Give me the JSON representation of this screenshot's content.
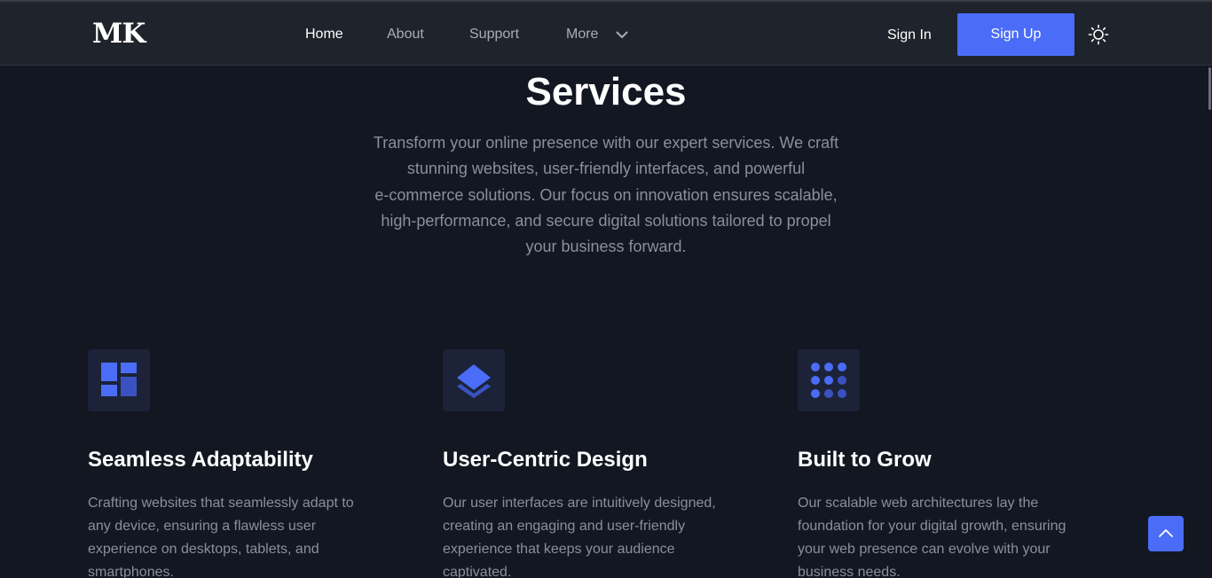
{
  "header": {
    "logo": "MK",
    "nav": [
      {
        "label": "Home",
        "active": true
      },
      {
        "label": "About",
        "active": false
      },
      {
        "label": "Support",
        "active": false
      },
      {
        "label": "More",
        "active": false
      }
    ],
    "sign_in": "Sign In",
    "sign_up": "Sign Up",
    "theme_icon": "sun-icon"
  },
  "section": {
    "title": "Services",
    "description_lines": [
      "Transform your online presence with our expert services. We craft",
      "stunning websites, user-friendly interfaces, and powerful",
      "e-commerce solutions. Our focus on innovation ensures scalable,",
      "high-performance, and secure digital solutions tailored to propel",
      "your business forward."
    ]
  },
  "features": [
    {
      "icon": "layout-grid-icon",
      "title": "Seamless Adaptability",
      "lines": [
        "Crafting websites that seamlessly adapt to",
        "any device, ensuring a flawless user",
        "experience on desktops, tablets, and",
        "smartphones."
      ]
    },
    {
      "icon": "layers-icon",
      "title": "User-Centric Design",
      "lines": [
        "Our user interfaces are intuitively designed,",
        "creating an engaging and user-friendly",
        "experience that keeps your audience",
        "captivated."
      ]
    },
    {
      "icon": "dots-grid-icon",
      "title": "Built to Grow",
      "lines": [
        "Our scalable web architectures lay the",
        "foundation for your digital growth, ensuring",
        "your web presence can evolve with your",
        "business needs."
      ]
    }
  ],
  "back_to_top_icon": "chevron-up-icon",
  "colors": {
    "background": "#131722",
    "header": "#1f232b",
    "accent": "#4a6cf7",
    "muted_text": "#8a8f99",
    "icon_box": "#1c2338"
  }
}
